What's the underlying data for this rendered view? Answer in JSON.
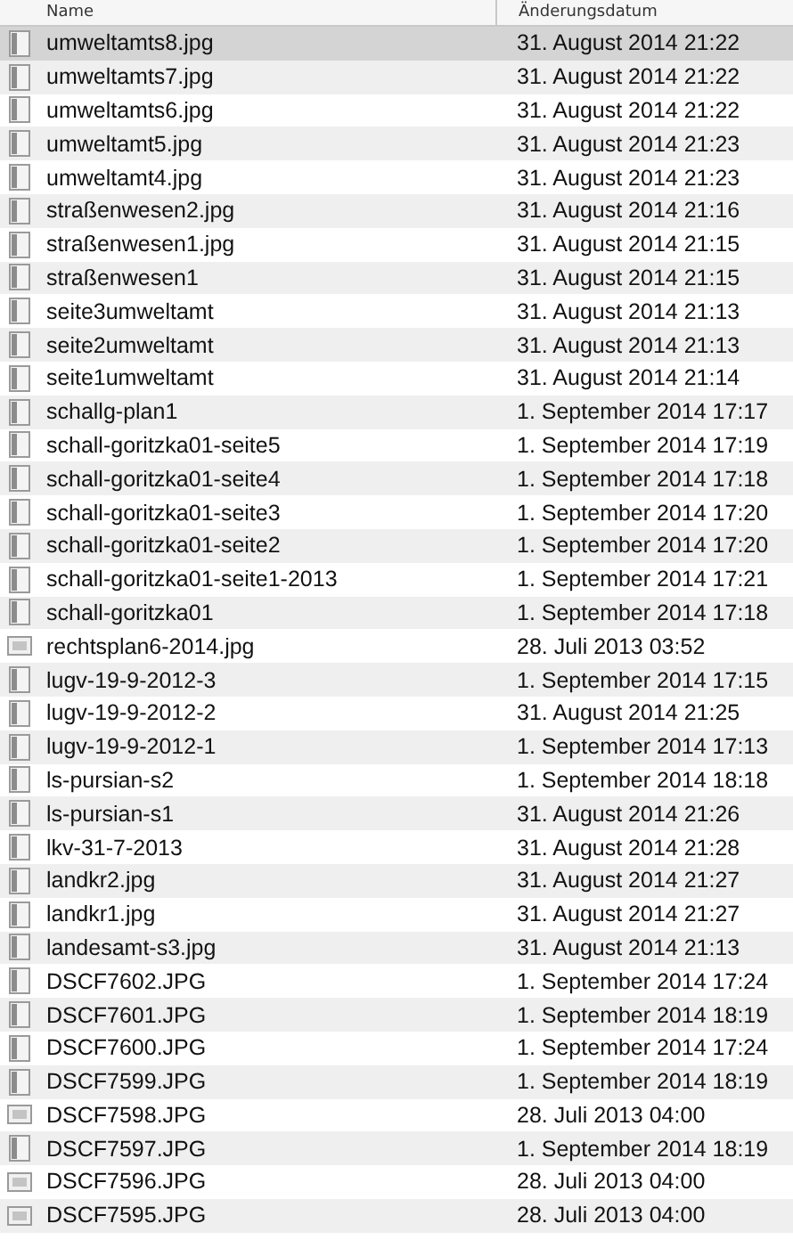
{
  "columns": [
    "Name",
    "Änderungsdatum"
  ],
  "rows": [
    {
      "name": "umweltamts8.jpg",
      "date": "31. August 2014 21:22",
      "kind": "document",
      "selected": true
    },
    {
      "name": "umweltamts7.jpg",
      "date": "31. August 2014 21:22",
      "kind": "document",
      "selected": false
    },
    {
      "name": "umweltamts6.jpg",
      "date": "31. August 2014 21:22",
      "kind": "document",
      "selected": false
    },
    {
      "name": "umweltamt5.jpg",
      "date": "31. August 2014 21:23",
      "kind": "document",
      "selected": false
    },
    {
      "name": "umweltamt4.jpg",
      "date": "31. August 2014 21:23",
      "kind": "document",
      "selected": false
    },
    {
      "name": "straßenwesen2.jpg",
      "date": "31. August 2014 21:16",
      "kind": "document",
      "selected": false
    },
    {
      "name": "straßenwesen1.jpg",
      "date": "31. August 2014 21:15",
      "kind": "document",
      "selected": false
    },
    {
      "name": "straßenwesen1",
      "date": "31. August 2014 21:15",
      "kind": "document",
      "selected": false
    },
    {
      "name": "seite3umweltamt",
      "date": "31. August 2014 21:13",
      "kind": "document",
      "selected": false
    },
    {
      "name": "seite2umweltamt",
      "date": "31. August 2014 21:13",
      "kind": "document",
      "selected": false
    },
    {
      "name": "seite1umweltamt",
      "date": "31. August 2014 21:14",
      "kind": "document",
      "selected": false
    },
    {
      "name": "schallg-plan1",
      "date": "1. September 2014 17:17",
      "kind": "document",
      "selected": false
    },
    {
      "name": "schall-goritzka01-seite5",
      "date": "1. September 2014 17:19",
      "kind": "document",
      "selected": false
    },
    {
      "name": "schall-goritzka01-seite4",
      "date": "1. September 2014 17:18",
      "kind": "document",
      "selected": false
    },
    {
      "name": "schall-goritzka01-seite3",
      "date": "1. September 2014 17:20",
      "kind": "document",
      "selected": false
    },
    {
      "name": "schall-goritzka01-seite2",
      "date": "1. September 2014 17:20",
      "kind": "document",
      "selected": false
    },
    {
      "name": "schall-goritzka01-seite1-2013",
      "date": "1. September 2014 17:21",
      "kind": "document",
      "selected": false
    },
    {
      "name": "schall-goritzka01",
      "date": "1. September 2014 17:18",
      "kind": "document",
      "selected": false
    },
    {
      "name": "rechtsplan6-2014.jpg",
      "date": "28. Juli 2013 03:52",
      "kind": "image",
      "selected": false
    },
    {
      "name": "lugv-19-9-2012-3",
      "date": "1. September 2014 17:15",
      "kind": "document",
      "selected": false
    },
    {
      "name": "lugv-19-9-2012-2",
      "date": "31. August 2014 21:25",
      "kind": "document",
      "selected": false
    },
    {
      "name": "lugv-19-9-2012-1",
      "date": "1. September 2014 17:13",
      "kind": "document",
      "selected": false
    },
    {
      "name": "ls-pursian-s2",
      "date": "1. September 2014 18:18",
      "kind": "document",
      "selected": false
    },
    {
      "name": "ls-pursian-s1",
      "date": "31. August 2014 21:26",
      "kind": "document",
      "selected": false
    },
    {
      "name": "lkv-31-7-2013",
      "date": "31. August 2014 21:28",
      "kind": "document",
      "selected": false
    },
    {
      "name": "landkr2.jpg",
      "date": "31. August 2014 21:27",
      "kind": "document",
      "selected": false
    },
    {
      "name": "landkr1.jpg",
      "date": "31. August 2014 21:27",
      "kind": "document",
      "selected": false
    },
    {
      "name": "landesamt-s3.jpg",
      "date": "31. August 2014 21:13",
      "kind": "document",
      "selected": false
    },
    {
      "name": "DSCF7602.JPG",
      "date": "1. September 2014 17:24",
      "kind": "document",
      "selected": false
    },
    {
      "name": "DSCF7601.JPG",
      "date": "1. September 2014 18:19",
      "kind": "document",
      "selected": false
    },
    {
      "name": "DSCF7600.JPG",
      "date": "1. September 2014 17:24",
      "kind": "document",
      "selected": false
    },
    {
      "name": "DSCF7599.JPG",
      "date": "1. September 2014 18:19",
      "kind": "document",
      "selected": false
    },
    {
      "name": "DSCF7598.JPG",
      "date": "28. Juli 2013 04:00",
      "kind": "image",
      "selected": false
    },
    {
      "name": "DSCF7597.JPG",
      "date": "1. September 2014 18:19",
      "kind": "document",
      "selected": false
    },
    {
      "name": "DSCF7596.JPG",
      "date": "28. Juli 2013 04:00",
      "kind": "image",
      "selected": false
    },
    {
      "name": "DSCF7595.JPG",
      "date": "28. Juli 2013 04:00",
      "kind": "image",
      "selected": false
    }
  ]
}
